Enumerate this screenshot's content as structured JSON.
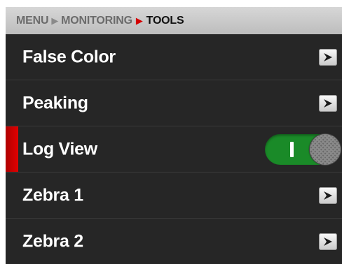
{
  "breadcrumb": {
    "items": [
      "MENU",
      "MONITORING",
      "TOOLS"
    ],
    "separator": ">",
    "active_color": "#d40000"
  },
  "menu": {
    "items": [
      {
        "label": "False Color",
        "control": "arrow"
      },
      {
        "label": "Peaking",
        "control": "arrow"
      },
      {
        "label": "Log View",
        "control": "toggle",
        "toggle_state": "on",
        "selected": true
      },
      {
        "label": "Zebra 1",
        "control": "arrow"
      },
      {
        "label": "Zebra 2",
        "control": "arrow"
      }
    ]
  },
  "icons": {
    "arrow": "chevron-right-icon"
  },
  "colors": {
    "background": "#262626",
    "toggle_on": "#1a8a28",
    "selection_marker": "#d40000"
  }
}
